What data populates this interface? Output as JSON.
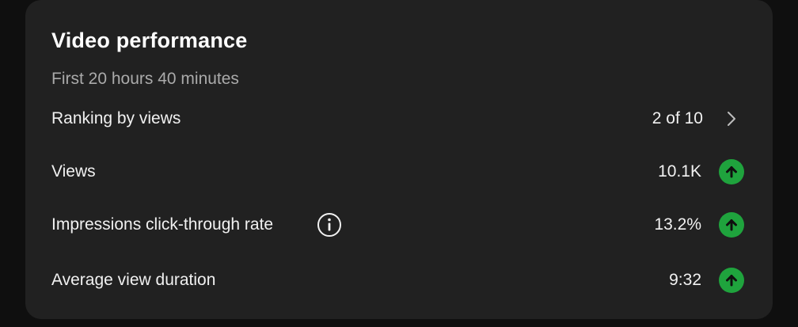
{
  "card": {
    "title": "Video performance",
    "subtitle": "First 20 hours 40 minutes"
  },
  "ranking": {
    "label": "Ranking by views",
    "value": "2 of 10",
    "icon": "chevron-right-icon"
  },
  "metrics": [
    {
      "label": "Views",
      "value": "10.1K",
      "trend": "up",
      "trend_icon": "arrow-up-icon"
    },
    {
      "label": "Impressions click-through rate",
      "value": "13.2%",
      "trend": "up",
      "trend_icon": "arrow-up-icon",
      "info_icon": "info-icon"
    },
    {
      "label": "Average view duration",
      "value": "9:32",
      "trend": "up",
      "trend_icon": "arrow-up-icon"
    }
  ],
  "colors": {
    "background": "#0f0f0f",
    "card": "#212121",
    "text": "#f1f1f1",
    "secondary_text": "#aaaaaa",
    "trend_up": "#1fa33d"
  }
}
